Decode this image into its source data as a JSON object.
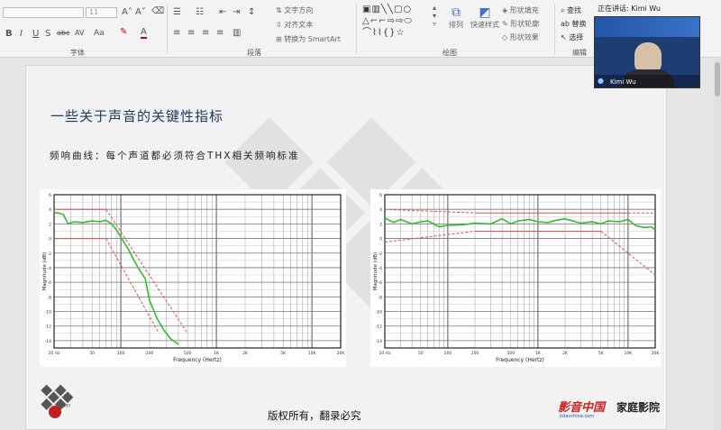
{
  "ribbon": {
    "groups": {
      "font": "字体",
      "paragraph": "段落",
      "drawing": "绘图",
      "editing": "编辑"
    },
    "paragraph": {
      "text_direction": "文字方向",
      "align_text": "对齐文本",
      "convert_smartart": "转换为 SmartArt"
    },
    "drawing": {
      "arrange": "排列",
      "quick_styles": "快速样式",
      "shape_fill": "形状填充",
      "shape_outline": "形状轮廓",
      "shape_effects": "形状效果"
    },
    "editing": {
      "find": "查找",
      "replace": "替换",
      "select": "选择"
    },
    "font": {
      "size": "11",
      "bold": "B",
      "italic": "I",
      "underline": "U",
      "strike": "S",
      "abc": "abc",
      "aa": "Aa",
      "grow": "A",
      "shrink": "A"
    }
  },
  "video": {
    "title": "正在讲话: Kimi Wu",
    "name": "Kimi Wu"
  },
  "slide": {
    "title": "一些关于声音的关键性指标",
    "subtitle": "频响曲线：每个声道都必须符合THX相关频响标准",
    "footer": "版权所有，翻录必究",
    "logo_right_text": "影音中国",
    "logo_right_url": "hdavchina.com",
    "logo_right_text2": "家庭影院"
  },
  "chart_data": [
    {
      "type": "line",
      "xlabel": "Frequency (Hertz)",
      "ylabel": "Magnitude (dB)",
      "x_scale": "log",
      "xlim": [
        20,
        20000
      ],
      "ylim": [
        -15,
        6
      ],
      "x_tick_labels": [
        "20 Hz",
        "50",
        "100",
        "200",
        "500",
        "1K",
        "2K",
        "5K",
        "10K",
        "20K"
      ],
      "y_tick_labels": [
        "6",
        "4",
        "2",
        "0",
        "-2",
        "-4",
        "-6",
        "-8",
        "-10",
        "-12",
        "-14"
      ],
      "series": [
        {
          "color": "#33bb33",
          "style": "solid",
          "x": [
            20,
            22,
            25,
            28,
            32,
            40,
            50,
            60,
            70,
            80,
            90,
            100,
            120,
            140,
            160,
            180,
            200,
            240,
            280,
            330,
            400
          ],
          "y": [
            3.5,
            3.5,
            3.3,
            2,
            2.3,
            2.2,
            2.4,
            2.3,
            2.5,
            2.0,
            1.2,
            0.2,
            -1.5,
            -3.2,
            -4.5,
            -5.5,
            -8.5,
            -11,
            -12.5,
            -13.7,
            -14.5
          ]
        },
        {
          "color": "#e05050",
          "style": "solid",
          "x": [
            20,
            70
          ],
          "y": [
            4,
            4
          ]
        },
        {
          "color": "#e05050",
          "style": "dashed",
          "x": [
            70,
            500
          ],
          "y": [
            4,
            -13
          ]
        },
        {
          "color": "#e05050",
          "style": "solid",
          "x": [
            20,
            70
          ],
          "y": [
            0,
            0
          ]
        },
        {
          "color": "#e05050",
          "style": "dashed",
          "x": [
            70,
            250
          ],
          "y": [
            0,
            -13
          ]
        }
      ]
    },
    {
      "type": "line",
      "xlabel": "Frequency (Hertz)",
      "ylabel": "Magnitude (dB)",
      "x_scale": "log",
      "xlim": [
        20,
        20000
      ],
      "ylim": [
        -15,
        6
      ],
      "x_tick_labels": [
        "20 Hz",
        "50",
        "100",
        "200",
        "500",
        "1K",
        "2K",
        "5K",
        "10K",
        "20K"
      ],
      "y_tick_labels": [
        "6",
        "4",
        "2",
        "0",
        "-2",
        "-4",
        "-6",
        "-8",
        "-10",
        "-12",
        "-14"
      ],
      "series": [
        {
          "color": "#33bb33",
          "style": "solid",
          "x": [
            20,
            25,
            30,
            40,
            50,
            60,
            80,
            100,
            150,
            200,
            300,
            400,
            500,
            600,
            800,
            1000,
            1300,
            1600,
            2000,
            3000,
            4000,
            5000,
            6000,
            8000,
            10000,
            12000,
            15000,
            18000,
            20000
          ],
          "y": [
            2.8,
            2.2,
            2.6,
            2.0,
            2.3,
            2.4,
            1.6,
            1.8,
            1.9,
            2.1,
            2.0,
            2.7,
            2.0,
            2.4,
            2.6,
            2.3,
            2.2,
            2.5,
            2.7,
            2.1,
            2.3,
            2.0,
            2.4,
            2.3,
            2.6,
            1.8,
            1.5,
            1.6,
            1.2
          ]
        },
        {
          "color": "#e05050",
          "style": "dashed",
          "x": [
            20,
            200
          ],
          "y": [
            4,
            3.5
          ]
        },
        {
          "color": "#e05050",
          "style": "solid",
          "x": [
            200,
            10000
          ],
          "y": [
            3.5,
            3.5
          ]
        },
        {
          "color": "#e05050",
          "style": "dashed",
          "x": [
            10000,
            20000
          ],
          "y": [
            3.5,
            3.5
          ]
        },
        {
          "color": "#e05050",
          "style": "dashed",
          "x": [
            20,
            200
          ],
          "y": [
            -0.5,
            1
          ]
        },
        {
          "color": "#e05050",
          "style": "solid",
          "x": [
            200,
            5000
          ],
          "y": [
            1,
            1
          ]
        },
        {
          "color": "#e05050",
          "style": "dashed",
          "x": [
            5000,
            20000
          ],
          "y": [
            1,
            -5
          ]
        }
      ]
    }
  ]
}
